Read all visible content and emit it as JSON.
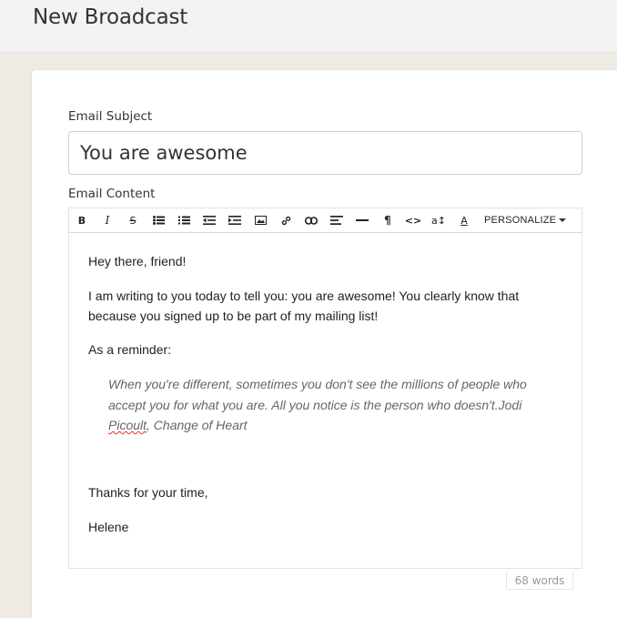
{
  "header": {
    "title": "New Broadcast"
  },
  "subject": {
    "label": "Email Subject",
    "value": "You are awesome"
  },
  "content": {
    "label": "Email Content"
  },
  "toolbar": {
    "buttons": [
      {
        "icon": "bold-icon",
        "glyph": "B"
      },
      {
        "icon": "italic-icon",
        "glyph": "I"
      },
      {
        "icon": "strikethrough-icon",
        "glyph": "S"
      },
      {
        "icon": "bullet-list-icon"
      },
      {
        "icon": "numbered-list-icon"
      },
      {
        "icon": "outdent-icon"
      },
      {
        "icon": "indent-icon"
      },
      {
        "icon": "image-icon"
      },
      {
        "icon": "link-icon"
      },
      {
        "icon": "chain-icon"
      },
      {
        "icon": "align-left-icon"
      },
      {
        "icon": "horizontal-rule-icon"
      },
      {
        "icon": "paragraph-icon",
        "glyph": "¶"
      },
      {
        "icon": "code-icon",
        "glyph": "<>"
      },
      {
        "icon": "font-size-icon",
        "glyph": "a↕"
      },
      {
        "icon": "text-color-icon",
        "glyph": "A"
      }
    ],
    "personalize_label": "PERSONALIZE"
  },
  "body": {
    "greeting": "Hey there, friend!",
    "paragraph1_line1": "I am writing to you today to tell you: you are awesome! You clearly know that",
    "paragraph1_line2": "because you signed up to be part of my mailing list!",
    "reminder": "As a reminder:",
    "quote_line1": "When you're different, sometimes you don't see the millions of people who",
    "quote_line2": "accept you for what you are. All you notice is the person who doesn't.Jodi",
    "quote_line3_word": "Picoult",
    "quote_line3_rest": ", Change of Heart",
    "thanks": "Thanks for your time,",
    "signature": "Helene"
  },
  "footer": {
    "word_count": "68 words"
  }
}
